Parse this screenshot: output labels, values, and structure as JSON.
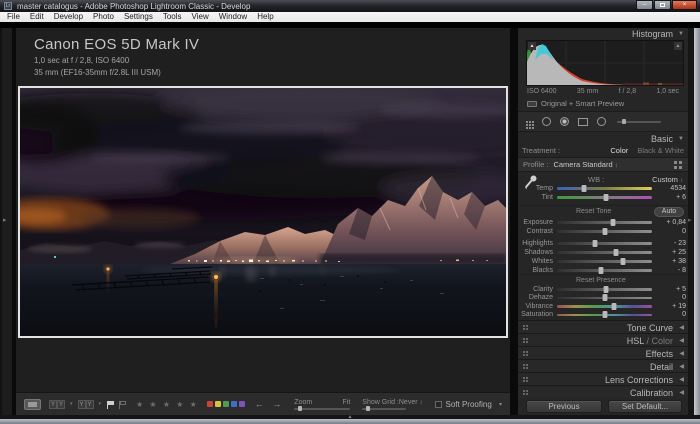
{
  "titlebar": {
    "title": "master catalogus - Adobe Photoshop Lightroom Classic - Develop",
    "app_icon": "Lr",
    "minimize": "–",
    "close": "×"
  },
  "menu": {
    "items": [
      "File",
      "Edit",
      "Develop",
      "Photo",
      "Settings",
      "Tools",
      "View",
      "Window",
      "Help"
    ]
  },
  "overlay": {
    "line1": "Canon EOS 5D Mark IV",
    "line2": "1,0 sec at f / 2,8, ISO 6400",
    "line3": "35 mm (EF16-35mm f/2.8L III USM)"
  },
  "histogram": {
    "title": "Histogram",
    "exif": [
      "ISO 6400",
      "35 mm",
      "f / 2,8",
      "1,0 sec"
    ],
    "preview_label": "Original + Smart Preview"
  },
  "basic": {
    "title": "Basic",
    "treatment_label": "Treatment :",
    "treatment_color": "Color",
    "treatment_bw": "Black & White",
    "profile_label": "Profile :",
    "profile_value": "Camera Standard",
    "wb_label": "WB :",
    "wb_value": "Custom",
    "reset_tone": "Reset Tone",
    "auto": "Auto",
    "reset_presence": "Reset Presence",
    "wb_sliders": [
      {
        "label": "Temp",
        "value": "4534",
        "pos": 28,
        "track": "temp"
      },
      {
        "label": "Tint",
        "value": "+ 6",
        "pos": 52,
        "track": "tint"
      }
    ],
    "tone_sliders": [
      {
        "label": "Exposure",
        "value": "+ 0,84",
        "pos": 59,
        "track": "gray"
      },
      {
        "label": "Contrast",
        "value": "0",
        "pos": 50,
        "track": "gray"
      },
      {
        "label": "Highlights",
        "value": "- 23",
        "pos": 40,
        "track": "gray"
      },
      {
        "label": "Shadows",
        "value": "+ 25",
        "pos": 62,
        "track": "gray"
      },
      {
        "label": "Whites",
        "value": "+ 38",
        "pos": 69,
        "track": "gray"
      },
      {
        "label": "Blacks",
        "value": "- 8",
        "pos": 46,
        "track": "gray"
      }
    ],
    "presence_sliders": [
      {
        "label": "Clarity",
        "value": "+ 5",
        "pos": 52,
        "track": "gray"
      },
      {
        "label": "Dehaze",
        "value": "0",
        "pos": 50,
        "track": "gray"
      },
      {
        "label": "Vibrance",
        "value": "+ 19",
        "pos": 60,
        "track": "rainbow"
      },
      {
        "label": "Saturation",
        "value": "0",
        "pos": 50,
        "track": "rainbow"
      }
    ]
  },
  "panels": [
    {
      "label": "Tone Curve",
      "dim": ""
    },
    {
      "label": "HSL",
      "dim": " / Color"
    },
    {
      "label": "Effects",
      "dim": ""
    },
    {
      "label": "Detail",
      "dim": ""
    },
    {
      "label": "Lens Corrections",
      "dim": ""
    },
    {
      "label": "Calibration",
      "dim": ""
    }
  ],
  "footer_buttons": {
    "previous": "Previous",
    "set_default": "Set Default..."
  },
  "toolbar": {
    "zoom_label": "Zoom",
    "fit_label": "Fit",
    "grid_label": "Show Grid :",
    "grid_value": "Never",
    "soft_proofing": "Soft Proofing",
    "stars": "★ ★ ★ ★ ★",
    "chips": [
      "#c84438",
      "#d4c23c",
      "#4f9c4f",
      "#3f6fc4",
      "#7e52bc"
    ]
  }
}
